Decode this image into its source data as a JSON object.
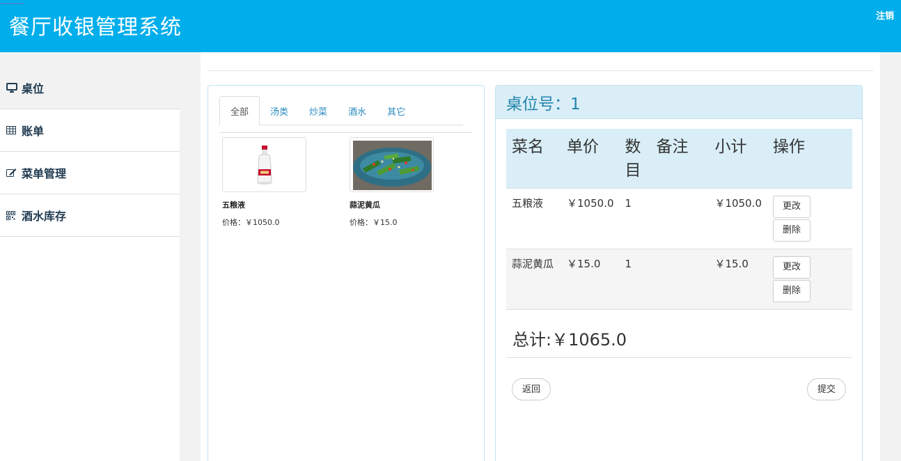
{
  "app": {
    "title": "餐厅收银管理系统",
    "logout_label": "注销"
  },
  "sidebar": {
    "items": [
      {
        "label": "桌位",
        "icon": "monitor-icon",
        "active": true
      },
      {
        "label": "账单",
        "icon": "table-icon"
      },
      {
        "label": "菜单管理",
        "icon": "edit-icon"
      },
      {
        "label": "酒水库存",
        "icon": "qrcode-icon"
      }
    ]
  },
  "menu": {
    "tabs": [
      {
        "label": "全部",
        "active": true
      },
      {
        "label": "汤类"
      },
      {
        "label": "炒菜"
      },
      {
        "label": "酒水"
      },
      {
        "label": "其它"
      }
    ],
    "dishes": [
      {
        "name": "五粮液",
        "price": "价格：￥1050.0",
        "image": "liquor-bottle"
      },
      {
        "name": "蒜泥黄瓜",
        "price": "价格：￥15.0",
        "image": "cucumber-dish"
      }
    ]
  },
  "order": {
    "title": "桌位号：1",
    "columns": [
      "菜名",
      "单价",
      "数目",
      "备注",
      "小计",
      "操作"
    ],
    "rows": [
      {
        "name": "五粮液",
        "unit_price": "￥1050.0",
        "qty": "1",
        "note": "",
        "subtotal": "￥1050.0",
        "edit": "更改",
        "delete": "删除"
      },
      {
        "name": "蒜泥黄瓜",
        "unit_price": "￥15.0",
        "qty": "1",
        "note": "",
        "subtotal": "￥15.0",
        "edit": "更改",
        "delete": "删除"
      }
    ],
    "total": "总计:￥1065.0",
    "back_label": "返回",
    "submit_label": "提交"
  },
  "colors": {
    "header": "#00aeeb",
    "panel_head": "#d9eef7",
    "link": "#2a8bbf"
  }
}
